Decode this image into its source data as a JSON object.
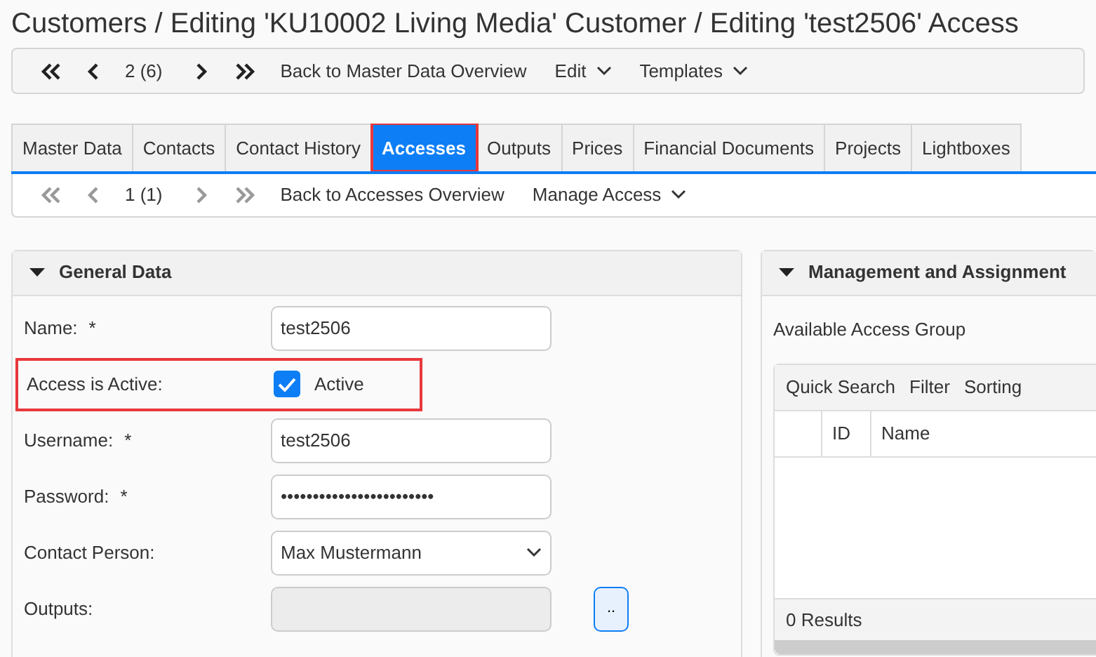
{
  "page_title": "Customers / Editing 'KU10002 Living Media' Customer / Editing 'test2506' Access",
  "record_nav": {
    "buttons": [
      {
        "kind": "first",
        "disabled": false
      },
      {
        "kind": "prev",
        "disabled": false
      }
    ],
    "position": "2 (6)",
    "buttons_after": [
      {
        "kind": "next",
        "disabled": false
      },
      {
        "kind": "last",
        "disabled": false
      }
    ],
    "menus": [
      {
        "label": "Back to Master Data Overview",
        "dropdown": false
      },
      {
        "label": "Edit",
        "dropdown": true
      },
      {
        "label": "Templates",
        "dropdown": true
      }
    ]
  },
  "tabs": [
    {
      "label": "Master Data",
      "selected": false,
      "highlighted": false
    },
    {
      "label": "Contacts",
      "selected": false,
      "highlighted": false
    },
    {
      "label": "Contact History",
      "selected": false,
      "highlighted": false
    },
    {
      "label": "Accesses",
      "selected": true,
      "highlighted": true
    },
    {
      "label": "Outputs",
      "selected": false,
      "highlighted": false
    },
    {
      "label": "Prices",
      "selected": false,
      "highlighted": false
    },
    {
      "label": "Financial Documents",
      "selected": false,
      "highlighted": false
    },
    {
      "label": "Projects",
      "selected": false,
      "highlighted": false
    },
    {
      "label": "Lightboxes",
      "selected": false,
      "highlighted": false
    }
  ],
  "sub_nav": {
    "buttons": [
      {
        "kind": "first",
        "disabled": true
      },
      {
        "kind": "prev",
        "disabled": true
      }
    ],
    "position": "1 (1)",
    "buttons_after": [
      {
        "kind": "next",
        "disabled": true
      },
      {
        "kind": "last",
        "disabled": true
      }
    ],
    "menus": [
      {
        "label": "Back to Accesses Overview",
        "dropdown": false
      },
      {
        "label": "Manage Access",
        "dropdown": true
      }
    ]
  },
  "general_data": {
    "title": "General Data",
    "expanded": true,
    "fields": [
      {
        "kind": "text",
        "label": "Name:",
        "required_mark": "*",
        "value": "test2506"
      },
      {
        "kind": "checkbox",
        "label": "Access is Active:",
        "checked": true,
        "caption": "Active",
        "highlighted": true
      },
      {
        "kind": "text",
        "label": "Username:",
        "required_mark": "*",
        "value": "test2506"
      },
      {
        "kind": "text",
        "label": "Password:",
        "required_mark": "*",
        "value": "••••••••••••••••••••••••"
      },
      {
        "kind": "select",
        "label": "Contact Person:",
        "value": "Max Mustermann"
      },
      {
        "kind": "picker",
        "label": "Outputs:",
        "disabled": true,
        "button": ".."
      }
    ]
  },
  "management": {
    "title": "Management and Assignment",
    "expanded": true,
    "subtitle": "Available Access Group",
    "grid": {
      "toolbar": [
        "Quick Search",
        "Filter",
        "Sorting"
      ],
      "columns": [
        "ID",
        "Name"
      ],
      "footer": "0 Results"
    }
  }
}
